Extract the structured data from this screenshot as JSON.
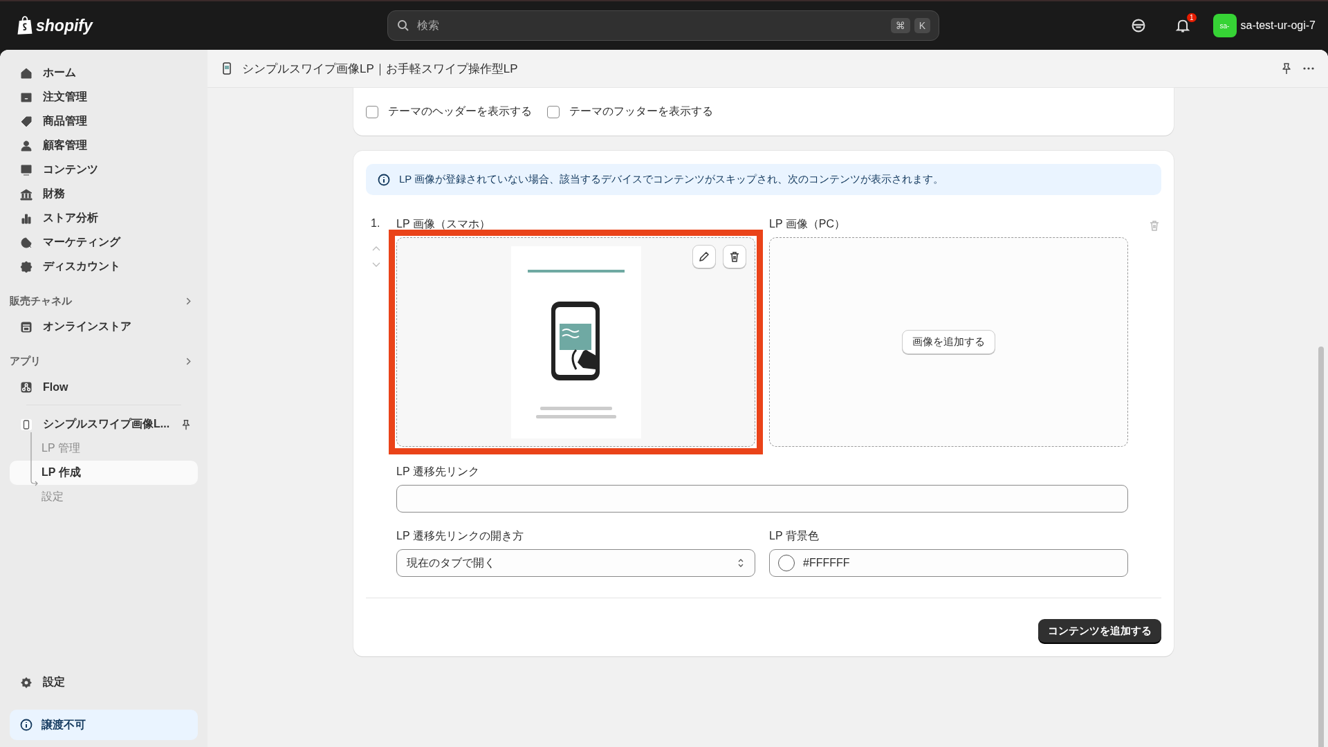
{
  "topbar": {
    "logo": "shopify",
    "search": {
      "placeholder": "検索",
      "keys": [
        "⌘",
        "K"
      ]
    },
    "notification_count": "1",
    "store": {
      "avatar": "sa-",
      "name": "sa-test-ur-ogi-7"
    }
  },
  "sidebar": {
    "nav": [
      {
        "label": "ホーム"
      },
      {
        "label": "注文管理"
      },
      {
        "label": "商品管理"
      },
      {
        "label": "顧客管理"
      },
      {
        "label": "コンテンツ"
      },
      {
        "label": "財務"
      },
      {
        "label": "ストア分析"
      },
      {
        "label": "マーケティング"
      },
      {
        "label": "ディスカウント"
      }
    ],
    "sections": [
      {
        "title": "販売チャネル",
        "items": [
          {
            "label": "オンラインストア"
          }
        ]
      },
      {
        "title": "アプリ",
        "items": [
          {
            "label": "Flow"
          }
        ]
      }
    ],
    "app": {
      "label": "シンプルスワイプ画像L...",
      "children": [
        {
          "label": "LP 管理",
          "selected": false
        },
        {
          "label": "LP 作成",
          "selected": true
        },
        {
          "label": "設定",
          "selected": false
        }
      ]
    },
    "settings": "設定",
    "notice": "譲渡不可"
  },
  "page": {
    "title": "シンプルスワイプ画像LP｜お手軽スワイプ操作型LP"
  },
  "theme_card": {
    "checkboxes": [
      {
        "label": "テーマのヘッダーを表示する",
        "checked": false
      },
      {
        "label": "テーマのフッターを表示する",
        "checked": false
      }
    ]
  },
  "content_card": {
    "info": "LP 画像が登録されていない場合、該当するデバイスでコンテンツがスキップされ、次のコンテンツが表示されます。",
    "items": [
      {
        "number": "1.",
        "mobile_image": {
          "label": "LP 画像（スマホ）",
          "kind": "picture",
          "highlighted": true
        },
        "pc_image": {
          "label": "LP 画像（PC）",
          "button": "画像を追加する"
        },
        "link": {
          "label": "LP 遷移先リンク"
        },
        "open_mode": {
          "label": "LP 遷移先リンクの開き方",
          "value": "現在のタブで開く"
        },
        "background": {
          "label": "LP 背景色",
          "value": "#FFFFFF"
        }
      }
    ],
    "add_button": "コンテンツを追加する"
  }
}
